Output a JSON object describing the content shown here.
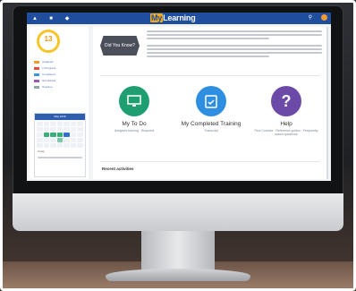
{
  "topbar": {
    "brand_prefix": "My",
    "brand_suffix": "Learning",
    "icons": [
      "home-icon",
      "bell-icon",
      "graduation-cap-icon",
      "search-icon",
      "user-avatar-icon"
    ]
  },
  "sidebar": {
    "ring_value": "13",
    "ring_label": "",
    "legend": [
      {
        "label": "Assigned",
        "color": "#f39b2d"
      },
      {
        "label": "In Progress",
        "color": "#e74c3c"
      },
      {
        "label": "Completed",
        "color": "#3498db"
      },
      {
        "label": "Not Started",
        "color": "#9b59b6"
      },
      {
        "label": "Overdue",
        "color": "#95a5a6"
      }
    ],
    "calendar": {
      "month": "May 2019",
      "footer": "Today"
    }
  },
  "main": {
    "did_you_know": "Did You Know?",
    "tiles": [
      {
        "title": "My To Do",
        "sub": "Assigned training · Required",
        "color": "#1f9e72",
        "icon": "monitor-icon"
      },
      {
        "title": "My Completed Training",
        "sub": "Transcript",
        "color": "#2e8fe0",
        "icon": "clipboard-check-icon"
      },
      {
        "title": "Help",
        "sub": "Find Courses · Reference guides · Frequently asked questions",
        "color": "#6c4aa8",
        "icon": "question-icon"
      }
    ],
    "recent_label": "Recent activities"
  },
  "colors": {
    "topbar": "#1f4e9c",
    "accent": "#f2a81d"
  }
}
